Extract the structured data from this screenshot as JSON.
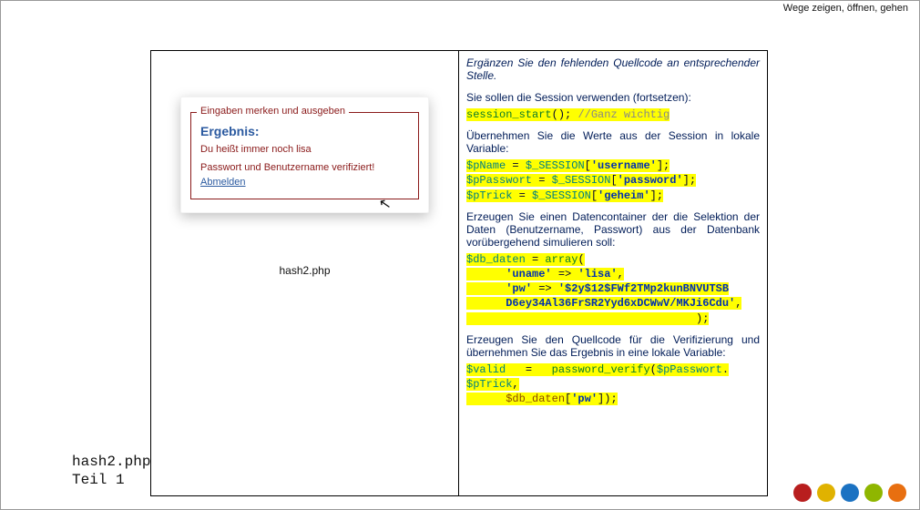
{
  "tagline": "Wege zeigen, öffnen, gehen",
  "footer": {
    "file": "hash2.php",
    "part": "Teil 1"
  },
  "left": {
    "legend": "Eingaben merken und ausgeben",
    "result_title": "Ergebnis:",
    "result_line": "Du heißt immer noch lisa",
    "verify_line": "Passwort und Benutzername verifiziert!",
    "logout": "Abmelden",
    "caption": "hash2.php"
  },
  "right": {
    "p1": "Ergänzen Sie den fehlenden Quellcode an entsprechender Stelle.",
    "p2": "Sie sollen die Session verwenden (fortsetzen):",
    "code1": {
      "fn": "session_start",
      "after": "(); ",
      "comment": "//Ganz wichtig"
    },
    "p3": "Übernehmen Sie die Werte aus der Session in lokale Variable:",
    "code2": {
      "l1v": "$pName",
      "l1m": " = ",
      "l1s": "$_SESSION",
      "l1b": "[",
      "l1k": "'username'",
      "l1e": "];",
      "l2v": "$pPasswort",
      "l2m": " = ",
      "l2s": "$_SESSION",
      "l2b": "[",
      "l2k": "'password'",
      "l2e": "];",
      "l3v": "$pTrick",
      "l3m": " = ",
      "l3s": "$_SESSION",
      "l3b": "[",
      "l3k": "'geheim'",
      "l3e": "];"
    },
    "p4": "Erzeugen Sie einen Datencontainer der die Selektion der Daten (Benutzername, Passwort) aus der Datenbank vorübergehend simulieren soll:",
    "code3": {
      "var": "$db_daten",
      "eq": " = ",
      "fn": "array",
      "open": "(",
      "k1": "'uname'",
      "arr1": " => ",
      "v1": "'lisa'",
      "c1": ",",
      "k2": "'pw'",
      "arr2": " => ",
      "v2a": "'$2y$12$FWf2TMp2kunBNVUTSB",
      "v2b": "D6ey34Al36FrSR2Yyd6xDCWwV/MKJi6Cdu'",
      "c2": ",",
      "close": ");"
    },
    "p5": "Erzeugen Sie den Quellcode für die Verifizierung und übernehmen Sie das Ergebnis in eine lokale Variable:",
    "code4": {
      "var": "$valid",
      "eq": "   =   ",
      "fn": "password_verify",
      "open": "(",
      "a1": "$pPasswort",
      "dot": ".",
      "a2": "$pTrick",
      "c1": ",",
      "arr": "$db_daten",
      "b1": "[",
      "k": "'pw'",
      "b2": "]);"
    }
  }
}
